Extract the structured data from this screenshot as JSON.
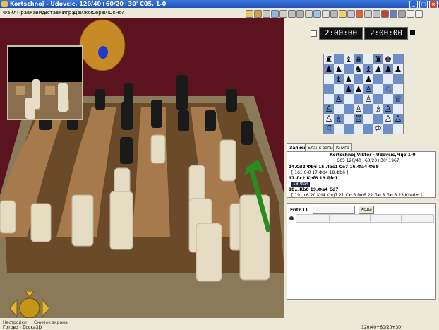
{
  "window": {
    "title": "Kortschnoj - Udovcic, 120/40+60/20+30' C05, 1-0",
    "controls": [
      "_",
      "□",
      "×"
    ]
  },
  "menu": [
    "Файл",
    "Правка",
    "Вид",
    "Вставка",
    "Игра",
    "Движок",
    "Сервис",
    "Окно",
    "?"
  ],
  "toolbar_icons": [
    "help-icon",
    "settings-icon",
    "engine-icon",
    "book-icon",
    "explorer-icon",
    "tools-icon",
    "gear-icon",
    "arrow-icon",
    "info-icon",
    "table-icon",
    "print-icon",
    "mail-icon",
    "save-icon",
    "flag-icon",
    "pieces-icon",
    "start-icon",
    "record-icon",
    "layout-icon",
    "view-icon",
    "minus-icon",
    "plus-icon"
  ],
  "clock": {
    "white": "2:00:00",
    "black": "2:00:00"
  },
  "tabs": [
    "Запись",
    "Бланк записи",
    "Книга"
  ],
  "notation": {
    "header": "Kortschnoj,Viktor - Udovcic,Mijo  1-0",
    "subheader": "C05 120/40+60/20+30' 1967",
    "lines": [
      "14.Cd2  Фb6  15.Лас1  Се7  16.Фа4  Фd8",
      "[ 16...0-0 17.Фd4  18.Фb6 ]",
      "17.Лс2  Крf8  18.Лfc1",
      "18.Фа4",
      "18...Кb6  19.Фа4  Cd7",
      "[ 19...c6 20.Kd4 Kpg7 21.Cxc6 fxc6 22.Лxc8 Лxc8 23.Kxe6+ ]"
    ]
  },
  "engine": {
    "name": "Fritz 11",
    "button": "Хода"
  },
  "status": {
    "left": "Готово - Доска3D",
    "middle": "120/40+60/20+30'",
    "bottom_buttons": [
      "Настройки",
      "Снимок экрана"
    ]
  },
  "mini_board": {
    "rows": [
      "♜ ♝♛ ♜♚ ",
      "♟♟ ♞♝♟♟♟",
      " ♝♟ ♟   ",
      "  ♟♟♙ ♘ ",
      " ♙  ♙  ♕",
      "♙  ♙ ♗♙ ",
      "♙♗ ♖  ♙♙",
      "♖    ♔  "
    ]
  }
}
